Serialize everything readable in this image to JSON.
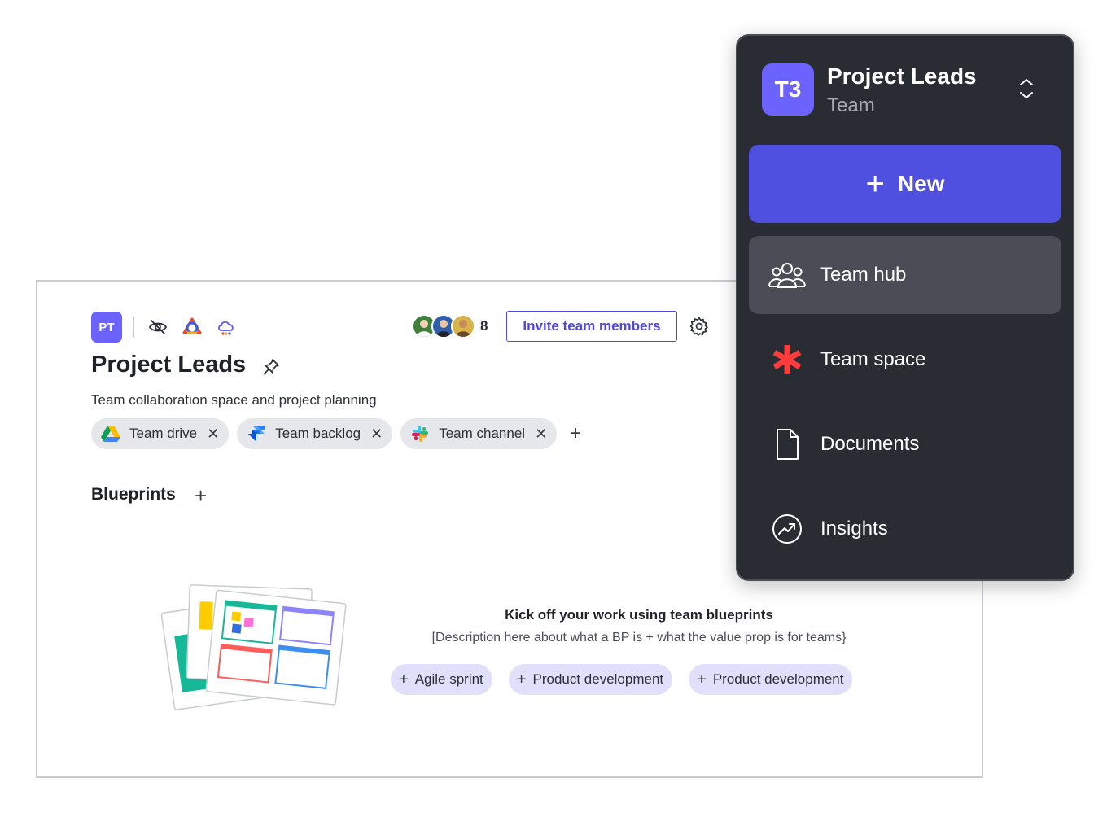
{
  "card": {
    "badge": "PT",
    "title": "Project Leads",
    "subtitle": "Team collaboration space and project planning",
    "member_count": "8",
    "invite_label": "Invite team members",
    "links": [
      {
        "label": "Team drive",
        "icon": "google-drive-icon"
      },
      {
        "label": "Team backlog",
        "icon": "jira-icon"
      },
      {
        "label": "Team channel",
        "icon": "slack-icon"
      }
    ],
    "blueprints": {
      "title": "Blueprints",
      "heading": "Kick off your work using team blueprints",
      "description": "[Description here about what a BP is + what the value prop is for teams}",
      "chips": [
        "Agile sprint",
        "Product development",
        "Product development"
      ]
    }
  },
  "panel": {
    "badge": "T3",
    "workspace_name": "Project Leads",
    "workspace_type": "Team",
    "new_label": "New",
    "nav": [
      {
        "label": "Team hub",
        "icon": "people-icon",
        "active": true
      },
      {
        "label": "Team space",
        "icon": "asterisk-icon",
        "active": false
      },
      {
        "label": "Documents",
        "icon": "document-icon",
        "active": false
      },
      {
        "label": "Insights",
        "icon": "trend-up-icon",
        "active": false
      }
    ]
  },
  "colors": {
    "accent": "#4f4fe0",
    "badge": "#6c63ff",
    "panel_bg": "#292c33",
    "chip_bg": "#e6e7ea",
    "bp_chip_bg": "#e0e0fb",
    "asterisk": "#ff3b3b"
  }
}
